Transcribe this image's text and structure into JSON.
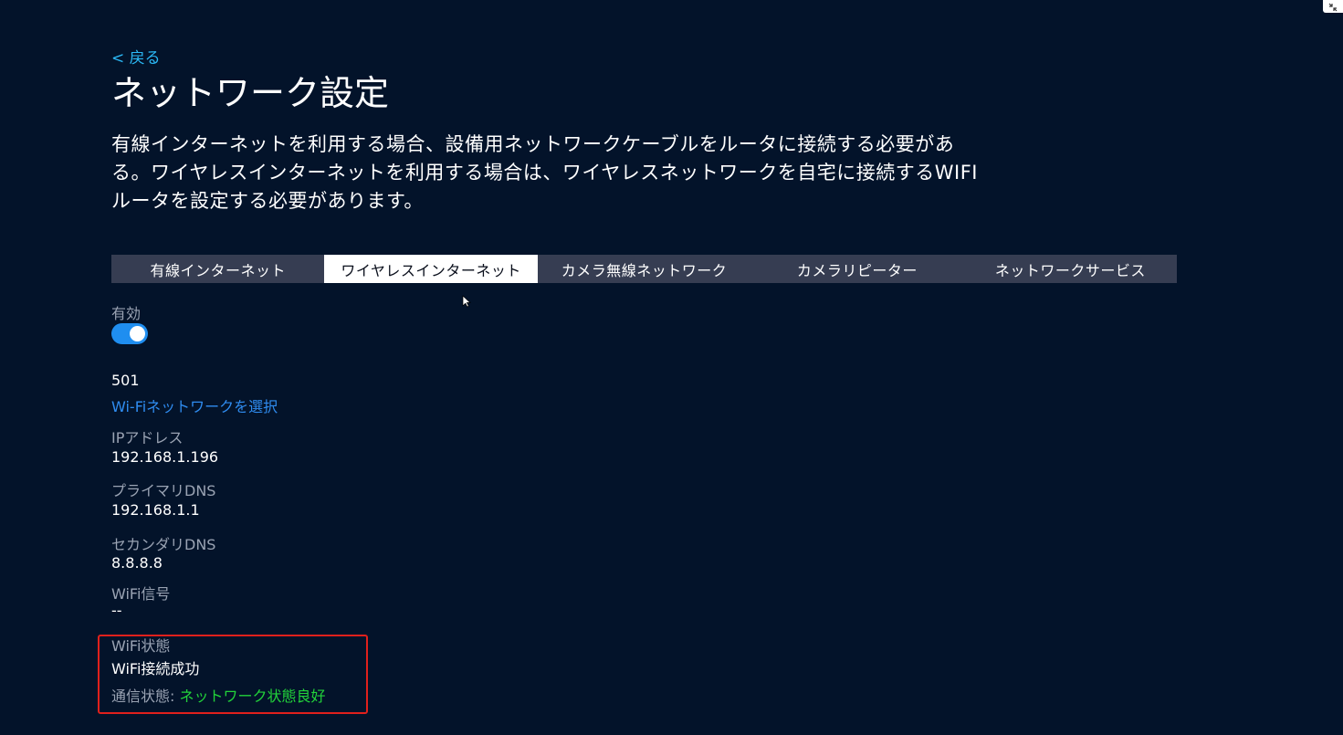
{
  "header": {
    "back_label": "< 戻る",
    "title": "ネットワーク設定",
    "description": "有線インターネットを利用する場合、設備用ネットワークケーブルをルータに接続する必要がある。ワイヤレスインターネットを利用する場合は、ワイヤレスネットワークを自宅に接続するWIFIルータを設定する必要があります。"
  },
  "tabs": [
    {
      "label": "有線インターネット",
      "active": false
    },
    {
      "label": "ワイヤレスインターネット",
      "active": true
    },
    {
      "label": "カメラ無線ネットワーク",
      "active": false
    },
    {
      "label": "カメラリピーター",
      "active": false
    },
    {
      "label": "ネットワークサービス",
      "active": false
    }
  ],
  "wireless": {
    "enabled_label": "有効",
    "enabled": true,
    "ssid": "501",
    "select_network_label": "Wi-Fiネットワークを選択",
    "ip_label": "IPアドレス",
    "ip_value": "192.168.1.196",
    "primary_dns_label": "プライマリDNS",
    "primary_dns_value": "192.168.1.1",
    "secondary_dns_label": "セカンダリDNS",
    "secondary_dns_value": "8.8.8.8",
    "signal_label": "WiFi信号",
    "signal_value": "--",
    "status_label": "WiFi状態",
    "status_value": "WiFi接続成功",
    "comm_label": "通信状態:",
    "comm_value": "ネットワーク状態良好"
  },
  "colors": {
    "background": "#03132a",
    "accent_link": "#2bb8f5",
    "toggle_on": "#1f8ef0",
    "status_good": "#22d23a",
    "highlight_border": "#e0201c"
  },
  "icons": {
    "pointer": "mouse-pointer-icon",
    "corner": "fullscreen-exit-icon"
  }
}
